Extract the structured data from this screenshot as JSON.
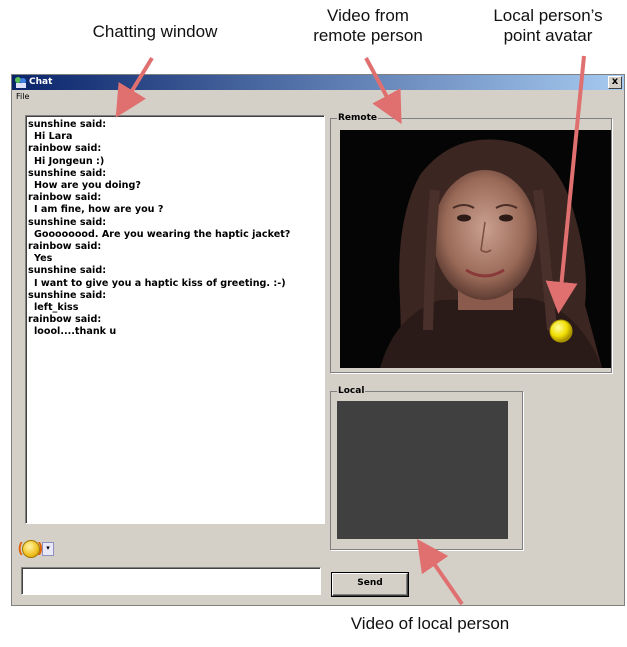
{
  "callouts": {
    "chat": "Chatting window",
    "remote_line1": "Video from",
    "remote_line2": "remote person",
    "avatar_line1": "Local person’s",
    "avatar_line2": "point avatar",
    "local": "Video of local person"
  },
  "window": {
    "title": "Chat",
    "close_symbol": "x",
    "menu": [
      "File"
    ]
  },
  "chat": {
    "messages": [
      {
        "speaker": "sunshine said:",
        "text": "Hi Lara"
      },
      {
        "speaker": "rainbow said:",
        "text": "Hi Jongeun :)"
      },
      {
        "speaker": "sunshine said:",
        "text": "How are you doing?"
      },
      {
        "speaker": "rainbow said:",
        "text": "I am fine, how are you ?"
      },
      {
        "speaker": "sunshine said:",
        "text": "Goooooood. Are you wearing the haptic jacket?"
      },
      {
        "speaker": "rainbow said:",
        "text": "Yes"
      },
      {
        "speaker": "sunshine said:",
        "text": "I want to give you a haptic kiss of greeting. :-)"
      },
      {
        "speaker": "sunshine said:",
        "text": "left_kiss"
      },
      {
        "speaker": "rainbow said:",
        "text": "loool....thank u"
      }
    ],
    "input_value": "",
    "emoji_icon": "smiley-icon",
    "emoji_dropdown_symbol": "▾"
  },
  "remote": {
    "label": "Remote"
  },
  "local": {
    "label": "Local"
  },
  "send_label": "Send",
  "colors": {
    "window_bg": "#d4d0c8",
    "arrow": "#e07070",
    "avatar": "#f5e000",
    "titlebar_start": "#0a246a"
  }
}
